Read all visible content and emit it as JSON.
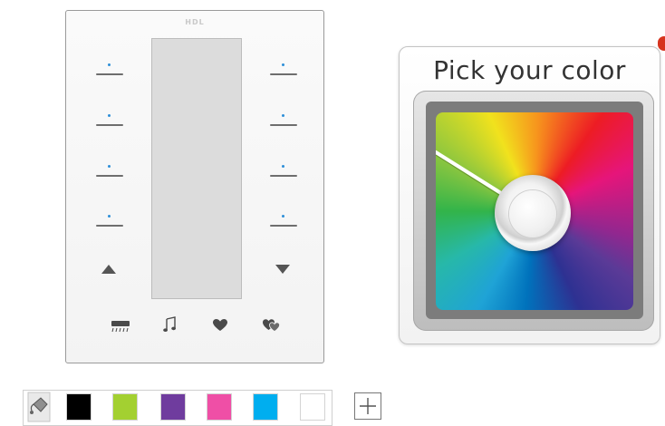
{
  "panel": {
    "brand": "HDL",
    "keys_left": [
      "key-1",
      "key-2",
      "key-3",
      "key-4"
    ],
    "keys_right": [
      "key-5",
      "key-6",
      "key-7",
      "key-8"
    ],
    "bottom_icons": [
      "air-conditioner-icon",
      "music-note-icon",
      "heart-icon",
      "double-heart-icon"
    ]
  },
  "picker": {
    "title": "Pick your color",
    "selected_color": "#c9d9e8"
  },
  "swatches": {
    "tool_icon": "paint-bucket-icon",
    "colors": [
      "#000000",
      "#a3d031",
      "#6f3c9e",
      "#ef4fa6",
      "#00aeef",
      "#ffffff"
    ],
    "add_icon": "plus-icon"
  }
}
